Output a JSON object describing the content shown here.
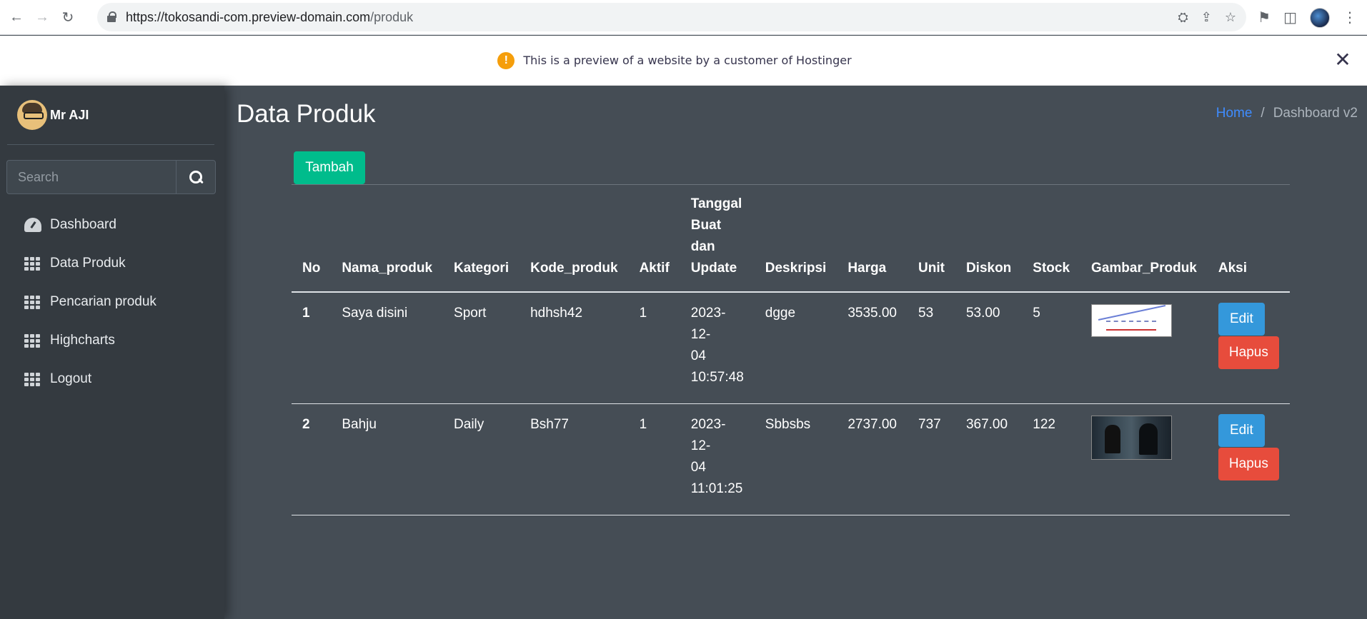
{
  "browser": {
    "url_host": "https://tokosandi-com.preview-domain.com",
    "url_path": "/produk"
  },
  "banner": {
    "text": "This is a preview of a website by a customer of Hostinger"
  },
  "sidebar": {
    "user_name": "Mr AJI",
    "search_placeholder": "Search",
    "items": [
      {
        "label": "Dashboard",
        "icon": "dashboard-gauge-icon"
      },
      {
        "label": "Data Produk",
        "icon": "grid-icon"
      },
      {
        "label": "Pencarian produk",
        "icon": "grid-icon"
      },
      {
        "label": "Highcharts",
        "icon": "grid-icon"
      },
      {
        "label": "Logout",
        "icon": "grid-icon"
      }
    ]
  },
  "main": {
    "title": "Data Produk",
    "breadcrumb": {
      "home": "Home",
      "separator": "/",
      "current": "Dashboard v2"
    },
    "add_button": "Tambah",
    "table": {
      "headers": [
        "No",
        "Nama_produk",
        "Kategori",
        "Kode_produk",
        "Aktif",
        "Tanggal Buat dan Update",
        "Deskripsi",
        "Harga",
        "Unit",
        "Diskon",
        "Stock",
        "Gambar_Produk",
        "Aksi"
      ],
      "rows": [
        {
          "no": "1",
          "nama": "Saya disini",
          "kategori": "Sport",
          "kode": "hdhsh42",
          "aktif": "1",
          "tanggal_date": "2023-12-",
          "tanggal_day": "04",
          "tanggal_time": "10:57:48",
          "deskripsi": "dgge",
          "harga": "3535.00",
          "unit": "53",
          "diskon": "53.00",
          "stock": "5",
          "edit": "Edit",
          "hapus": "Hapus"
        },
        {
          "no": "2",
          "nama": "Bahju",
          "kategori": "Daily",
          "kode": "Bsh77",
          "aktif": "1",
          "tanggal_date": "2023-12-",
          "tanggal_day": "04",
          "tanggal_time": "11:01:25",
          "deskripsi": "Sbbsbs",
          "harga": "2737.00",
          "unit": "737",
          "diskon": "367.00",
          "stock": "122",
          "edit": "Edit",
          "hapus": "Hapus"
        }
      ]
    }
  },
  "colors": {
    "content_bg": "#454d55",
    "sidebar_bg": "#343a40",
    "tambah": "#00bc8c",
    "edit": "#3498db",
    "hapus": "#e74c3c",
    "breadcrumb_link": "#3f8cff",
    "warning": "#f59e0b"
  }
}
